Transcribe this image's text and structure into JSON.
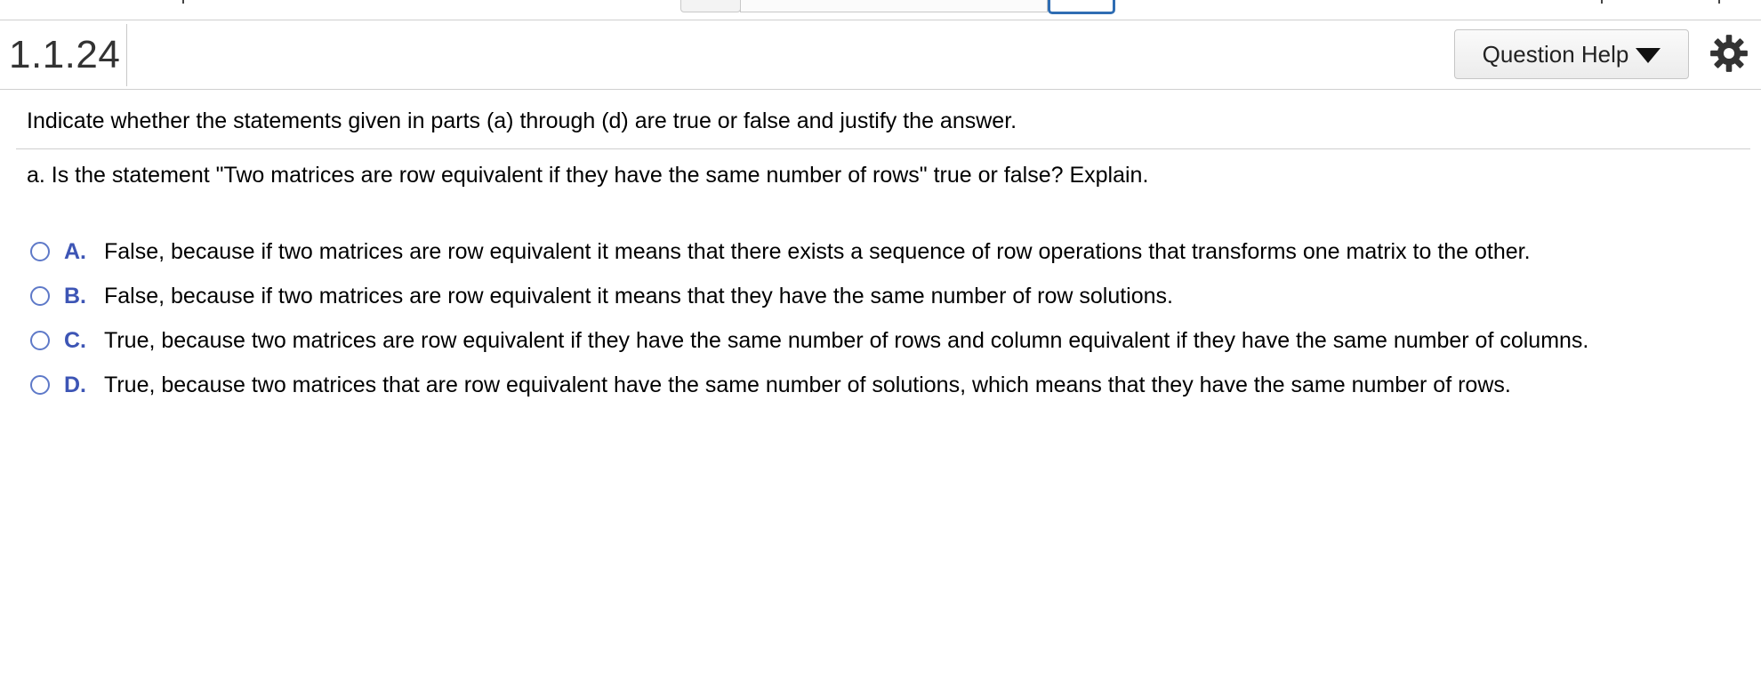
{
  "header": {
    "question_number": "1.1.24",
    "help_button_label": "Question Help"
  },
  "content": {
    "instructions": "Indicate whether the statements given in parts (a) through (d) are true or false and justify the answer.",
    "question": "a. Is the statement \"Two matrices are row equivalent if they have the same number of rows\" true or false? Explain.",
    "choices": [
      {
        "letter": "A.",
        "text": "False, because if two matrices are row equivalent it means that there exists a sequence of row operations that transforms one matrix to the other."
      },
      {
        "letter": "B.",
        "text": "False, because if two matrices are row equivalent it means that they have the same number of row solutions."
      },
      {
        "letter": "C.",
        "text": "True, because two matrices are row equivalent if they have the same number of rows and column equivalent if they have the same number of columns."
      },
      {
        "letter": "D.",
        "text": "True, because two matrices that are row equivalent have the same number of solutions, which means that they have the same number of rows."
      }
    ]
  },
  "icons": {
    "help_dropdown": "caret-down-icon",
    "settings": "gear-icon",
    "choice_marker": "radio-icon"
  },
  "colors": {
    "choice_letter": "#3d55b5",
    "radio_border": "#5e79c8",
    "top_box_accent": "#2f6db3",
    "divider": "#cfcfcf"
  }
}
